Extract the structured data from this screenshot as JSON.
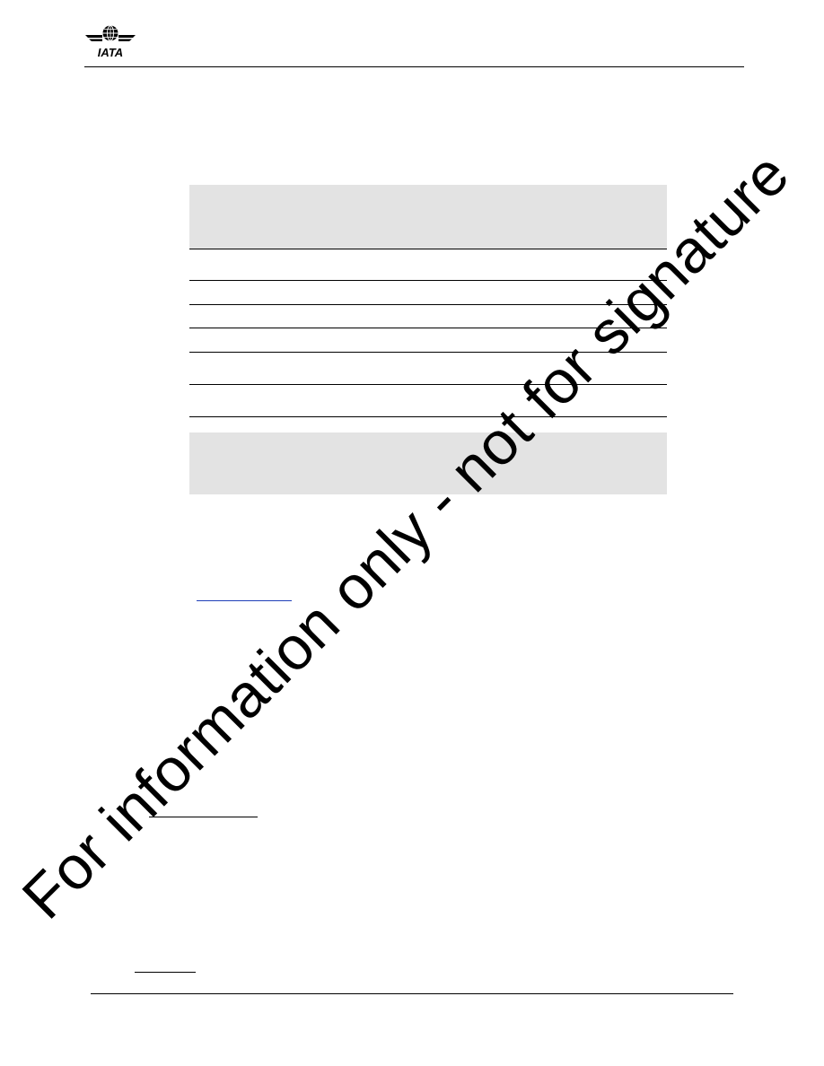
{
  "header": {
    "logo_text": "IATA",
    "logo_icon": "iata-globe-wings-logo"
  },
  "watermark": {
    "text": "For information only - not for signature"
  },
  "colors": {
    "table_band": "#e3e3e3",
    "link_underline": "#1f3fb8",
    "rule": "#000000"
  }
}
